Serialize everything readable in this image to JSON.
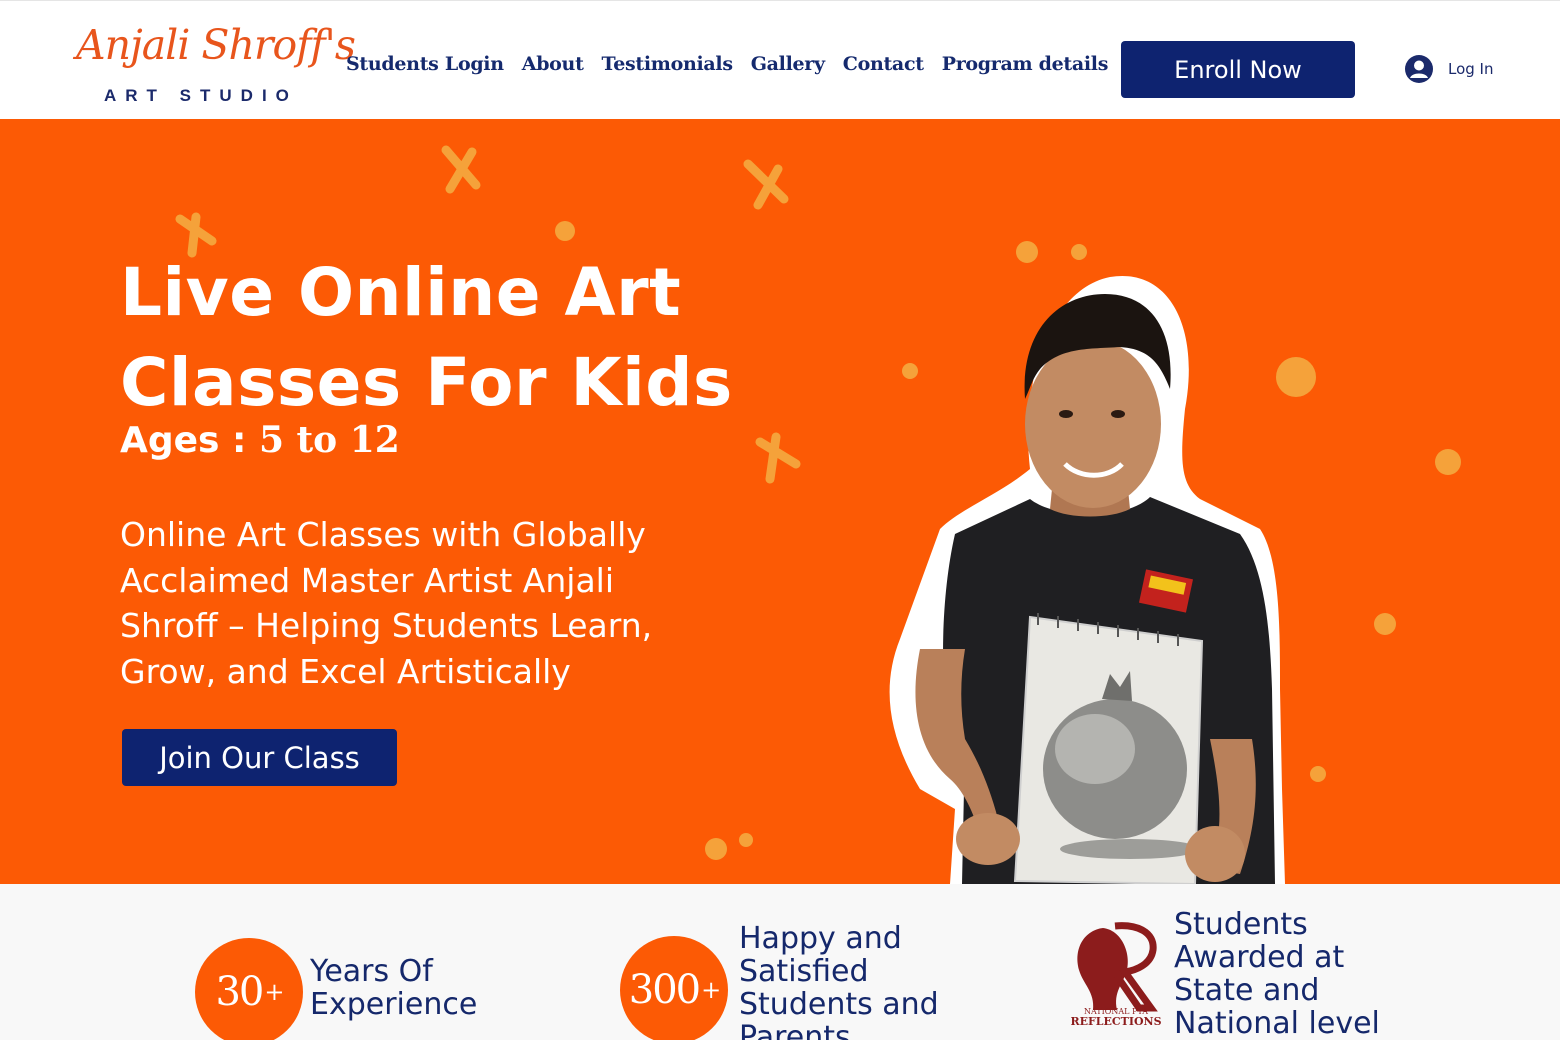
{
  "header": {
    "logo_script": "Anjali Shroff's",
    "logo_subtitle": "ART STUDIO",
    "nav": [
      "Students Login",
      "About",
      "Testimonials",
      "Gallery",
      "Contact",
      "Program details"
    ],
    "enroll_label": "Enroll Now",
    "login_label": "Log In"
  },
  "hero": {
    "title_line1": "Live Online Art",
    "title_line2": "Classes For Kids",
    "ages_label": "Ages :",
    "ages_value": "5 to 12",
    "subtitle": "Online Art Classes with Globally Acclaimed Master Artist Anjali Shroff – Helping Students Learn, Grow, and Excel Artistically",
    "cta_label": "Join Our Class",
    "background_color": "#fc5a05"
  },
  "stats": {
    "items": [
      {
        "value": "30",
        "suffix": "+",
        "label": "Years Of Experience"
      },
      {
        "value": "300",
        "suffix": "+",
        "label": "Happy and Satisfied Students and Parents"
      },
      {
        "label": "Students Awarded at State and National level"
      }
    ],
    "award_logo_line1": "NATIONAL PTA",
    "award_logo_line2": "REFLECTIONS"
  },
  "colors": {
    "accent_orange": "#fc5a05",
    "navy": "#0e2370",
    "nav_text": "#152a6e"
  }
}
